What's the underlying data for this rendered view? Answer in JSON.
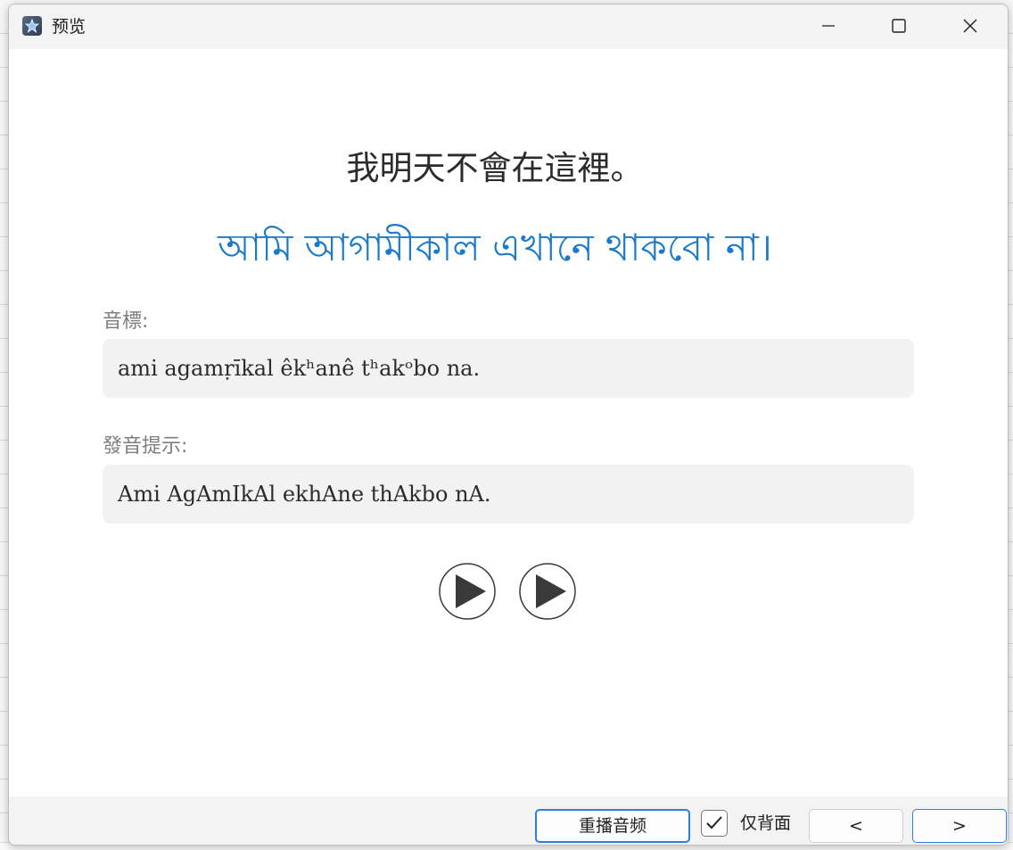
{
  "window": {
    "title": "预览"
  },
  "card": {
    "sentence_zh": "我明天不會在這裡。",
    "sentence_bn": "আমি আগামীকাল এখানে থাকবো না।",
    "phonetic_label": "音標:",
    "phonetic_value": "ami agamṛīkal êkʰanê tʰakᵒbo na.",
    "hint_label": "發音提示:",
    "hint_value": "Ami AgAmIkAl ekhAne thAkbo nA."
  },
  "icons": {
    "play_1": "play-icon",
    "play_2": "play-icon",
    "minimize": "minimize-icon",
    "maximize": "maximize-icon",
    "close": "close-icon",
    "app": "app-icon"
  },
  "bottom_bar": {
    "replay_label": "重播音频",
    "back_only_label": "仅背面",
    "back_only_checked": true,
    "prev_label": "<",
    "next_label": ">"
  },
  "colors": {
    "accent": "#2e7de0",
    "bengali_text": "#1b7ac8"
  }
}
